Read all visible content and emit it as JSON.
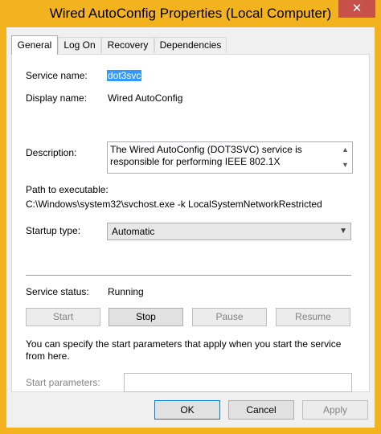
{
  "window": {
    "title": "Wired AutoConfig Properties (Local Computer)",
    "close_glyph": "✕",
    "accent_color": "#f3b31f",
    "close_color": "#c7504a"
  },
  "tabs": [
    {
      "label": "General",
      "active": true
    },
    {
      "label": "Log On",
      "active": false
    },
    {
      "label": "Recovery",
      "active": false
    },
    {
      "label": "Dependencies",
      "active": false
    }
  ],
  "general": {
    "service_name_label": "Service name:",
    "service_name_value": "dot3svc",
    "display_name_label": "Display name:",
    "display_name_value": "Wired AutoConfig",
    "description_label": "Description:",
    "description_value": "The Wired AutoConfig (DOT3SVC) service is responsible for performing IEEE 802.1X",
    "path_label": "Path to executable:",
    "path_value": "C:\\Windows\\system32\\svchost.exe -k LocalSystemNetworkRestricted",
    "startup_type_label": "Startup type:",
    "startup_type_value": "Automatic",
    "service_status_label": "Service status:",
    "service_status_value": "Running",
    "buttons": {
      "start": "Start",
      "stop": "Stop",
      "pause": "Pause",
      "resume": "Resume"
    },
    "help_text": "You can specify the start parameters that apply when you start the service from here.",
    "start_params_label": "Start parameters:",
    "start_params_value": ""
  },
  "footer": {
    "ok": "OK",
    "cancel": "Cancel",
    "apply": "Apply"
  },
  "icons": {
    "scroll_up": "▲",
    "scroll_down": "▼",
    "combo_arrow": "▼"
  }
}
